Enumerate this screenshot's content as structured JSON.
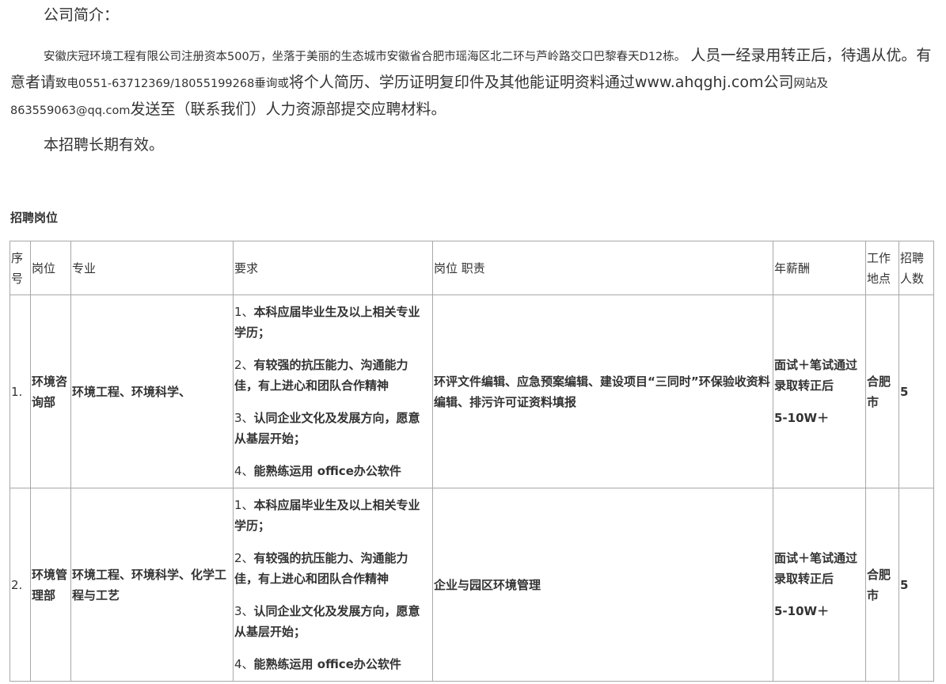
{
  "intro": {
    "heading": "公司简介：",
    "para_part1": "安徽庆冠环境工程有限公司注册资本500万，坐落于美丽的生态城市安徽省合肥市瑶海区北二环与芦岭路交口巴黎春天D12栋。",
    "para_part2": "人员一经录用转正后，待遇从优。有意者请",
    "para_part3": "致电",
    "para_part4": "0551-63712369/18055199268",
    "para_part5": "垂询或",
    "para_part6": "将个人简历、学历证明复印件及其他能证明资料通过www.ahqghj.com公司",
    "para_part7": "网站及",
    "para_part8": "863559063@qq.com",
    "para_part9": "发送至（联系我们）人力资源部提交应聘材料。",
    "validity": "本招聘长期有效。"
  },
  "section_title": "招聘岗位",
  "table": {
    "headers": {
      "seq": "序号",
      "position": "岗位",
      "major": "专业",
      "requirements": "要求",
      "duties": "岗位 职责",
      "salary": "年薪酬",
      "location": "工作地点",
      "headcount": "招聘人数"
    },
    "rows": [
      {
        "seq": "1.",
        "position": "环境咨询部",
        "major": "环境工程、环境科学、",
        "requirements": [
          {
            "num": "1、",
            "text": "本科应届毕业生及以上相关专业学历；"
          },
          {
            "num": "2、",
            "text": "有较强的抗压能力、沟通能力佳，有上进心和团队合作精神"
          },
          {
            "num": "3、",
            "text": "认同企业文化及发展方向，愿意从基层开始；"
          },
          {
            "num": "4、",
            "text": "能熟练运用 office办公软件"
          }
        ],
        "duties": "环评文件编辑、应急预案编辑、建设项目“三同时”环保验收资料编辑、排污许可证资料填报",
        "salary_line1": "面试＋笔试通过录取转正后",
        "salary_line2": "5-10W＋",
        "location": "合肥市",
        "headcount": "5"
      },
      {
        "seq": "2.",
        "position": "环境管理部",
        "major": "环境工程、环境科学、化学工程与工艺",
        "requirements": [
          {
            "num": "1、",
            "text": "本科应届毕业生及以上相关专业学历；"
          },
          {
            "num": "2、",
            "text": "有较强的抗压能力、沟通能力佳，有上进心和团队合作精神"
          },
          {
            "num": "3、",
            "text": "认同企业文化及发展方向，愿意从基层开始；"
          },
          {
            "num": "4、",
            "text": "能熟练运用 office办公软件"
          }
        ],
        "duties": "企业与园区环境管理",
        "salary_line1": "面试＋笔试通过录取转正后",
        "salary_line2": "5-10W＋",
        "location": "合肥市",
        "headcount": "5"
      }
    ]
  }
}
